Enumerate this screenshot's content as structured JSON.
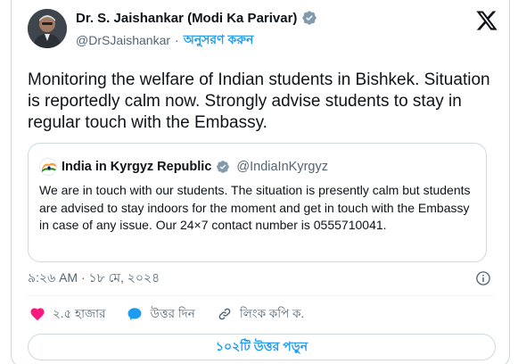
{
  "author": {
    "display_name": "Dr. S. Jaishankar (Modi Ka Parivar)",
    "handle": "@DrSJaishankar",
    "separator": "·",
    "follow_label": "অনুসরণ করুন"
  },
  "tweet": {
    "text": "Monitoring the welfare of Indian students in Bishkek. Situation is reportedly calm now. Strongly advise students to stay in regular touch with the Embassy."
  },
  "quoted": {
    "display_name": "India in Kyrgyz Republic",
    "handle": "@IndiaInKyrgyz",
    "text": "We are in touch with our students. The situation is presently calm but students are advised to stay indoors for the moment and get in touch with the Embassy in case of any issue. Our 24×7 contact number is 0555710041."
  },
  "meta": {
    "timestamp": "৯:২৬ AM · ১৮ মে, ২০২৪"
  },
  "actions": {
    "like_count": "২.৫ হাজার",
    "reply_label": "উত্তর দিন",
    "copy_link_label": "লিংক কপি ক."
  },
  "replies_button": {
    "label": "১০২টি উত্তর পড়ুন"
  },
  "colors": {
    "brand_blue": "#1d9bf0",
    "like_pink": "#f91880",
    "verified_gray": "#829aab",
    "text_primary": "#0f1419",
    "text_secondary": "#536471"
  },
  "icons": {
    "verified": "verified-badge-icon",
    "x_logo": "x-logo-icon",
    "info": "info-icon",
    "like": "heart-icon",
    "reply": "speech-bubble-icon",
    "copy_link": "link-icon"
  }
}
